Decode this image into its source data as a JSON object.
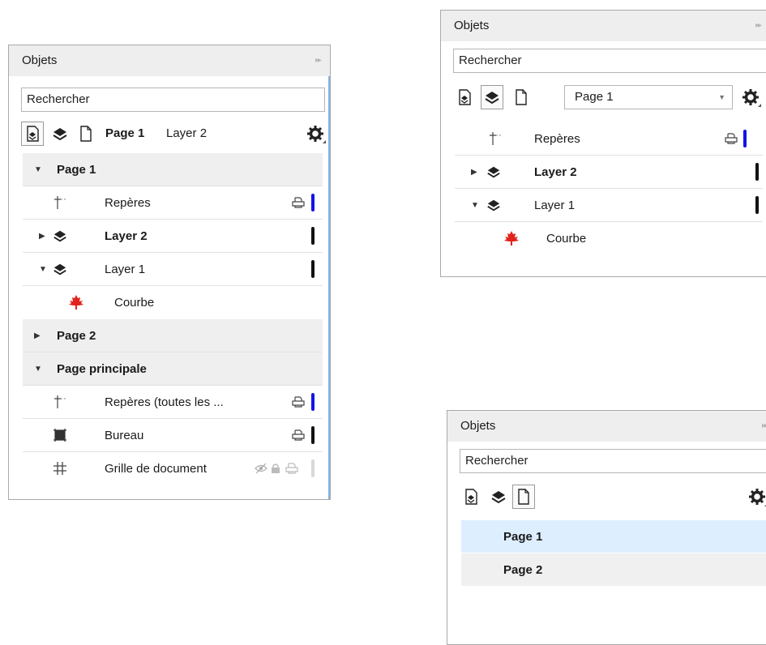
{
  "accent_color": "#1414e6",
  "panels": {
    "left": {
      "title": "Objets",
      "search_placeholder": "Rechercher",
      "toolbar": {
        "page": "Page 1",
        "layer": "Layer 2"
      },
      "tree": [
        {
          "label": "Page 1",
          "kind": "page",
          "expanded": true
        },
        {
          "label": "Repères",
          "kind": "guides"
        },
        {
          "label": "Layer 2",
          "kind": "layer",
          "expanded": false
        },
        {
          "label": "Layer 1",
          "kind": "layer",
          "expanded": true
        },
        {
          "label": "Courbe",
          "kind": "object"
        },
        {
          "label": "Page 2",
          "kind": "page",
          "expanded": false
        },
        {
          "label": "Page principale",
          "kind": "page",
          "expanded": true
        },
        {
          "label": "Repères (toutes les ...",
          "kind": "guides"
        },
        {
          "label": "Bureau",
          "kind": "desktop"
        },
        {
          "label": "Grille de document",
          "kind": "grid"
        }
      ]
    },
    "top_right": {
      "title": "Objets",
      "search_placeholder": "Rechercher",
      "page_select": "Page 1",
      "tree": [
        {
          "label": "Repères",
          "kind": "guides"
        },
        {
          "label": "Layer 2",
          "kind": "layer",
          "expanded": false
        },
        {
          "label": "Layer 1",
          "kind": "layer",
          "expanded": true
        },
        {
          "label": "Courbe",
          "kind": "object"
        }
      ]
    },
    "bottom_right": {
      "title": "Objets",
      "search_placeholder": "Rechercher",
      "pages": [
        {
          "label": "Page 1",
          "selected": true
        },
        {
          "label": "Page 2",
          "selected": false
        }
      ]
    }
  }
}
